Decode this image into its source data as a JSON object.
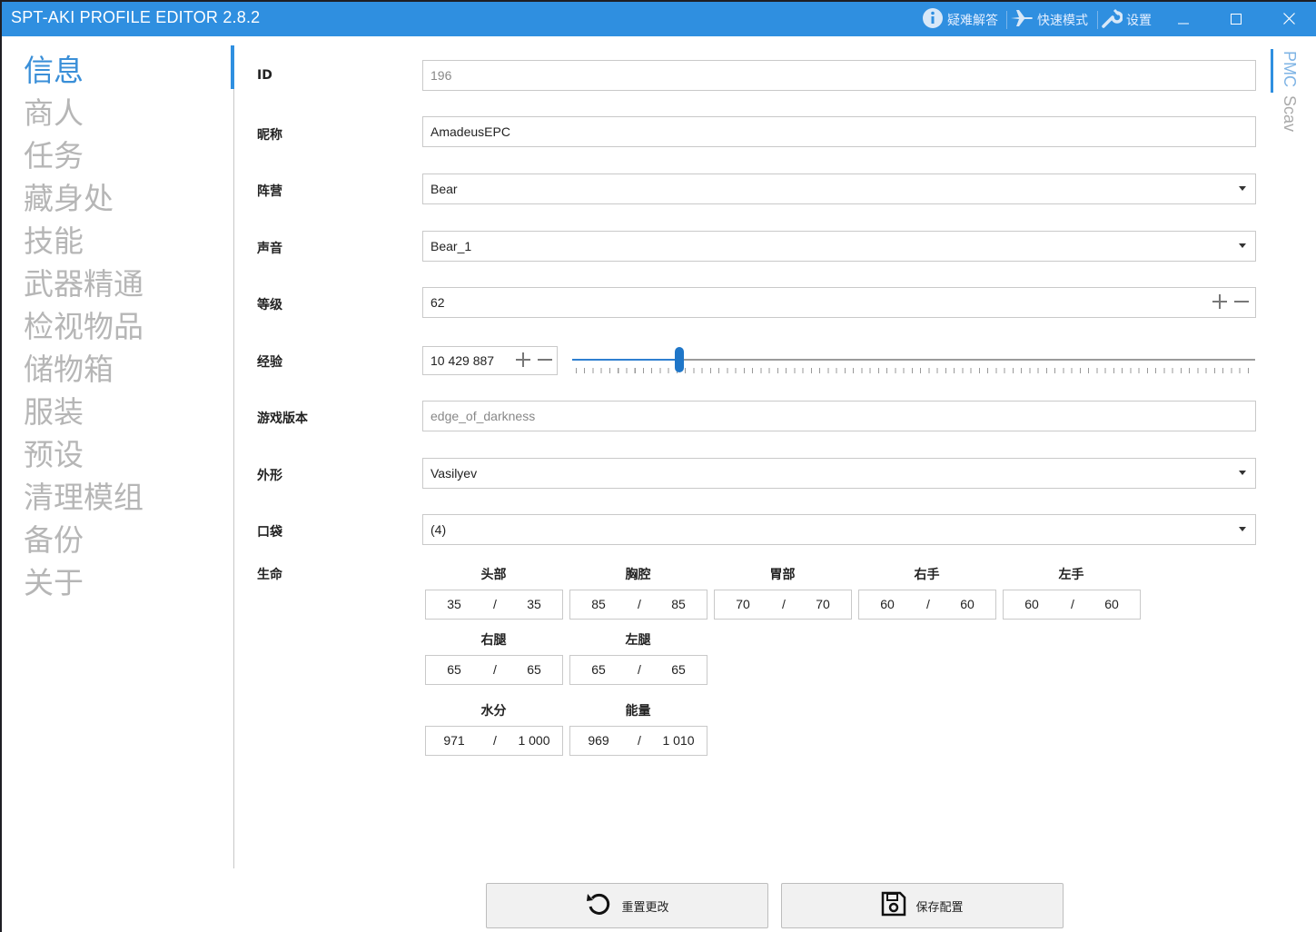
{
  "app": {
    "title": "SPT-AKI PROFILE EDITOR  2.8.2"
  },
  "titlebar": {
    "help_label": "疑难解答",
    "fast_mode_label": "快速模式",
    "settings_label": "设置"
  },
  "nav": {
    "items": [
      "信息",
      "商人",
      "任务",
      "藏身处",
      "技能",
      "武器精通",
      "检视物品",
      "储物箱",
      "服装",
      "预设",
      "清理模组",
      "备份",
      "关于"
    ],
    "active": 0
  },
  "side_tabs": {
    "pmc": "PMC",
    "scav": "Scav"
  },
  "form": {
    "id_label": "ID",
    "id_value": "196",
    "nickname_label": "昵称",
    "nickname_value": "AmadeusEPC",
    "side_label": "阵营",
    "side_value": "Bear",
    "voice_label": "声音",
    "voice_value": "Bear_1",
    "level_label": "等级",
    "level_value": "62",
    "exp_label": "经验",
    "exp_value": "10 429 887",
    "exp_slider_fraction": 0.157,
    "game_version_label": "游戏版本",
    "game_version_value": "edge_of_darkness",
    "head_label": "外形",
    "head_value": "Vasilyev",
    "pockets_label": "口袋",
    "pockets_value": "(4)",
    "health_label": "生命"
  },
  "health": {
    "parts": [
      {
        "name": "头部",
        "current": "35",
        "max": "35"
      },
      {
        "name": "胸腔",
        "current": "85",
        "max": "85"
      },
      {
        "name": "胃部",
        "current": "70",
        "max": "70"
      },
      {
        "name": "右手",
        "current": "60",
        "max": "60"
      },
      {
        "name": "左手",
        "current": "60",
        "max": "60"
      },
      {
        "name": "右腿",
        "current": "65",
        "max": "65"
      },
      {
        "name": "左腿",
        "current": "65",
        "max": "65"
      },
      {
        "name": "水分",
        "current": "971",
        "max": "1 000"
      },
      {
        "name": "能量",
        "current": "969",
        "max": "1 010"
      }
    ],
    "separator": "/"
  },
  "buttons": {
    "reset": "重置更改",
    "save": "保存配置"
  },
  "icons": {
    "help": "info-circle-icon",
    "fast": "airplane-icon",
    "settings": "wrench-icon",
    "reset": "undo-icon",
    "save": "floppy-disk-icon"
  },
  "colors": {
    "accent": "#2f8fe0",
    "nav_inactive": "#b6b6b6"
  }
}
